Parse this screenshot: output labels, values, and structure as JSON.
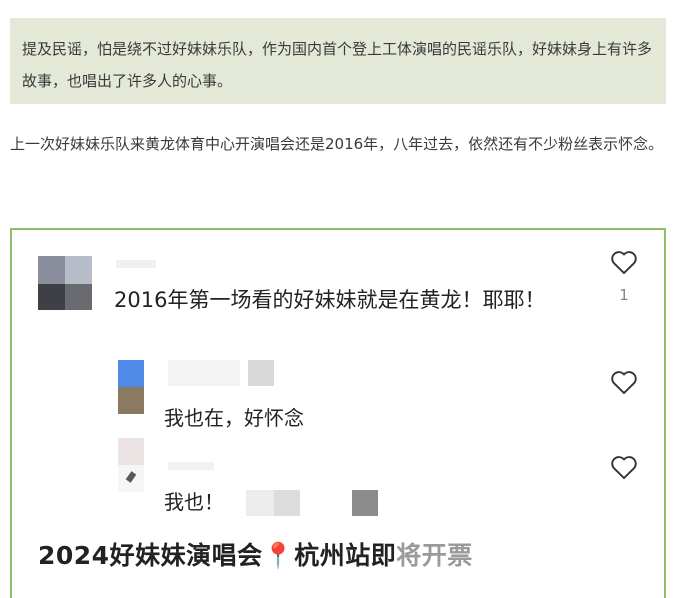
{
  "quote_box": {
    "text": "提及民谣，怕是绕不过好妹妹乐队，作为国内首个登上工体演唱的民谣乐队，好妹妹身上有许多故事，也唱出了许多人的心事。"
  },
  "paragraph": {
    "text": "上一次好妹妹乐队来黄龙体育中心开演唱会还是2016年，八年过去，依然还有不少粉丝表示怀念。"
  },
  "comments": [
    {
      "text": "2016年第一场看的好妹妹就是在黄龙！耶耶！",
      "likes": "1"
    },
    {
      "text": "我也在，好怀念",
      "likes": ""
    },
    {
      "text": "我也！",
      "likes": ""
    }
  ],
  "bottom_title": {
    "main": "2024好妹妹演唱会",
    "pin_icon": "📍",
    "city": "杭州站即",
    "faded": "将开票"
  },
  "colors": {
    "quote_bg": "#e3e8d7",
    "frame_border": "#8cc06a",
    "pin": "#e2463a"
  }
}
